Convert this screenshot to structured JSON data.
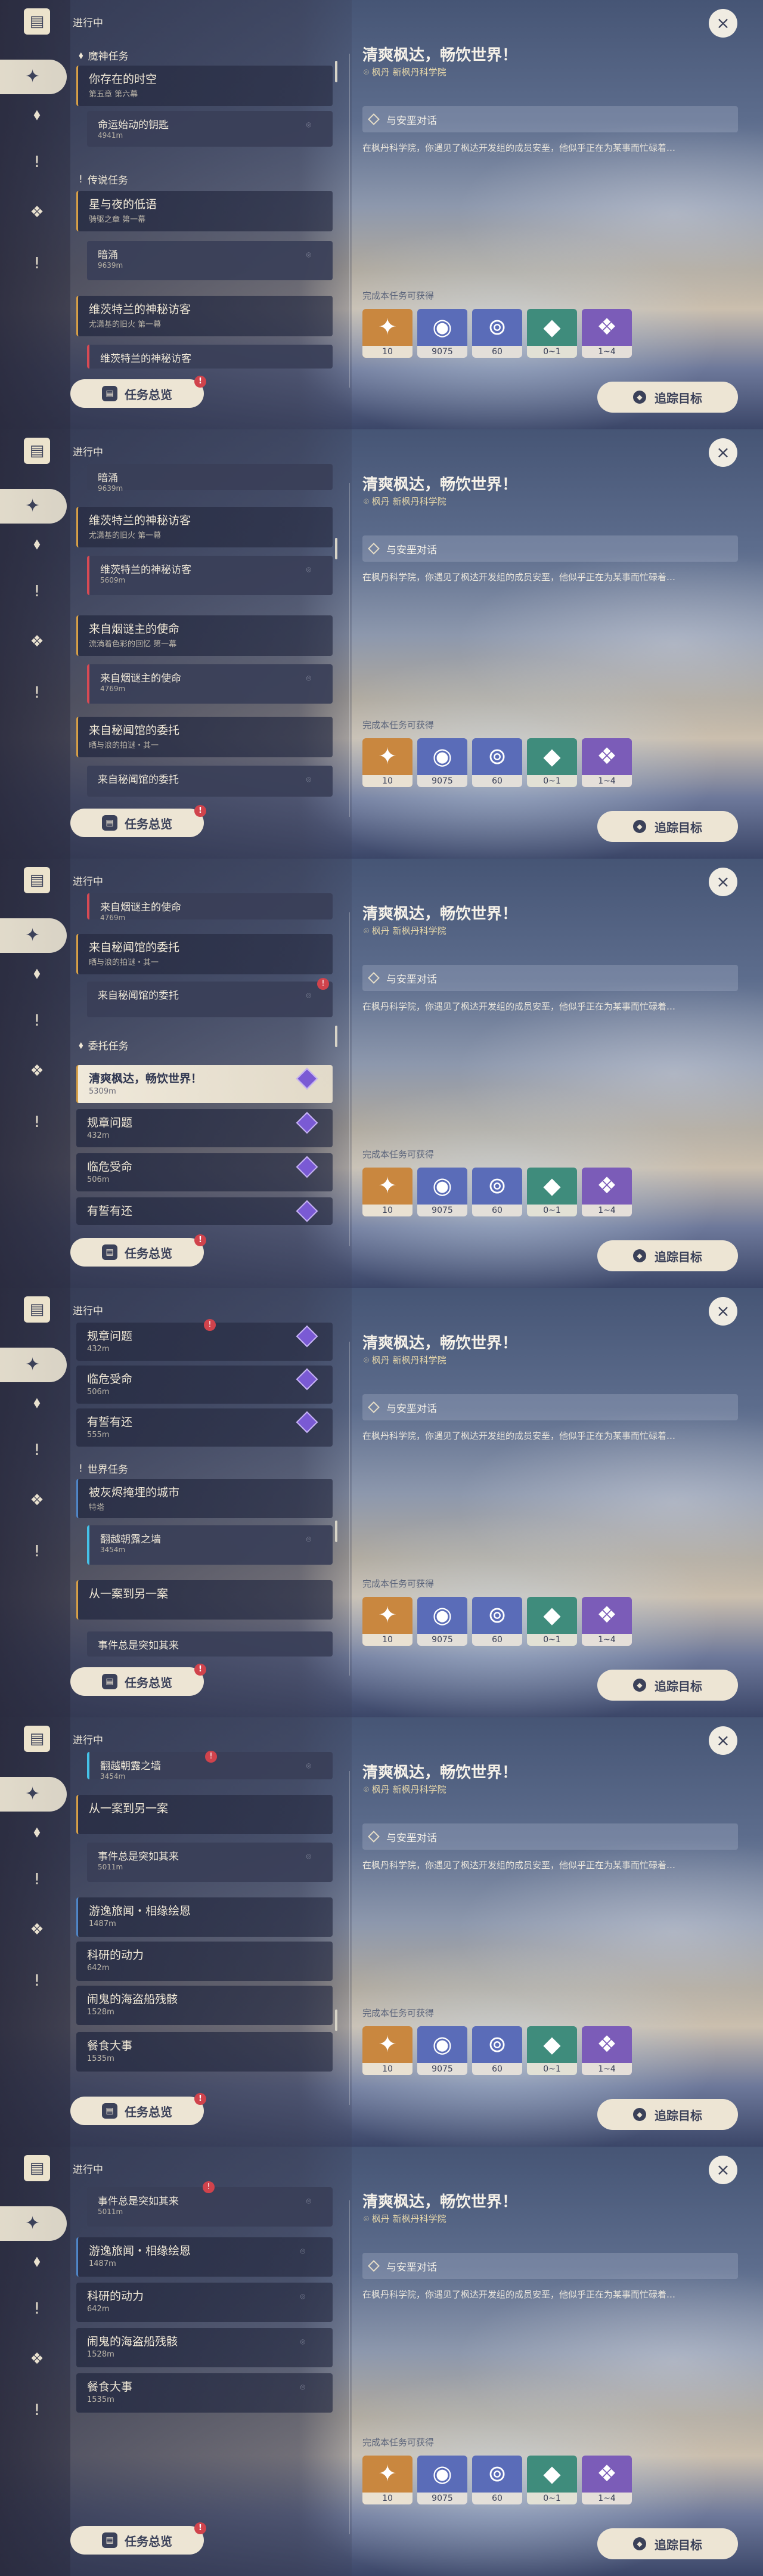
{
  "app": {
    "section_heading": "进行中"
  },
  "categories": {
    "archon": "魔神任务",
    "legend": "传说任务",
    "commission": "委托任务",
    "world": "世界任务"
  },
  "quests": {
    "q1": {
      "title": "你存在的时空",
      "sub": "第五章 第六幕"
    },
    "q1a": {
      "title": "命运始动的钥匙",
      "sub": "4941m"
    },
    "q2": {
      "title": "星与夜的低语",
      "sub": "骑驱之章 第一幕"
    },
    "q2a": {
      "title": "暗涌",
      "sub": "9639m"
    },
    "q3": {
      "title": "维茨特兰的神秘访客",
      "sub": "尤潇基的旧火 第一幕"
    },
    "q3a": {
      "title": "维茨特兰的神秘访客",
      "sub": "5609m"
    },
    "q4": {
      "title": "来自烟谜主的使命",
      "sub": "流淌着色彩的回忆 第一幕"
    },
    "q4a": {
      "title": "来自烟谜主的使命",
      "sub": "4769m"
    },
    "q5": {
      "title": "来自秘闻馆的委托",
      "sub": "晒与浪的拍谜・其一"
    },
    "q5a": {
      "title": "来自秘闻馆的委托",
      "sub": ""
    },
    "c1": {
      "title": "清爽枫达，畅饮世界！",
      "sub": "5309m"
    },
    "c2": {
      "title": "规章问题",
      "sub": "432m"
    },
    "c3": {
      "title": "临危受命",
      "sub": "506m"
    },
    "c4": {
      "title": "有誓有还",
      "sub": "555m"
    },
    "w1": {
      "title": "被灰烬掩埋的城市",
      "sub": "特塔"
    },
    "w1a": {
      "title": "翻越朝露之墙",
      "sub": "3454m"
    },
    "w2": {
      "title": "从一案到另一案",
      "sub": ""
    },
    "w2a": {
      "title": "事件总是突如其来",
      "sub": "5011m"
    },
    "w3": {
      "title": "游逸旅闻・相缘绘恩",
      "sub": "1487m"
    },
    "w4": {
      "title": "科研的动力",
      "sub": "642m"
    },
    "w5": {
      "title": "闹鬼的海盗船残骸",
      "sub": "1528m"
    },
    "w6": {
      "title": "餐食大事",
      "sub": "1535m"
    }
  },
  "detail": {
    "title": "清爽枫达，畅饮世界！",
    "location": "枫丹 新枫丹科学院",
    "goal": "与安垩对话",
    "description": "在枫丹科学院，你遇见了枫达开发组的成员安垩，他似乎正在为某事而忙碌着…",
    "rewards_label": "完成本任务可获得",
    "rewards": [
      {
        "name": "原石",
        "amount": "10"
      },
      {
        "name": "摩拉",
        "amount": "9075"
      },
      {
        "name": "冒险阅历",
        "amount": "60"
      },
      {
        "name": "结晶",
        "amount": "0~1"
      },
      {
        "name": "精炼",
        "amount": "1~4"
      }
    ]
  },
  "buttons": {
    "overview": "任务总览",
    "track": "追踪目标",
    "badge": "!"
  },
  "icons": {
    "close": "×",
    "pin": "⌖",
    "book": "▤",
    "map_pin": "⌾"
  }
}
